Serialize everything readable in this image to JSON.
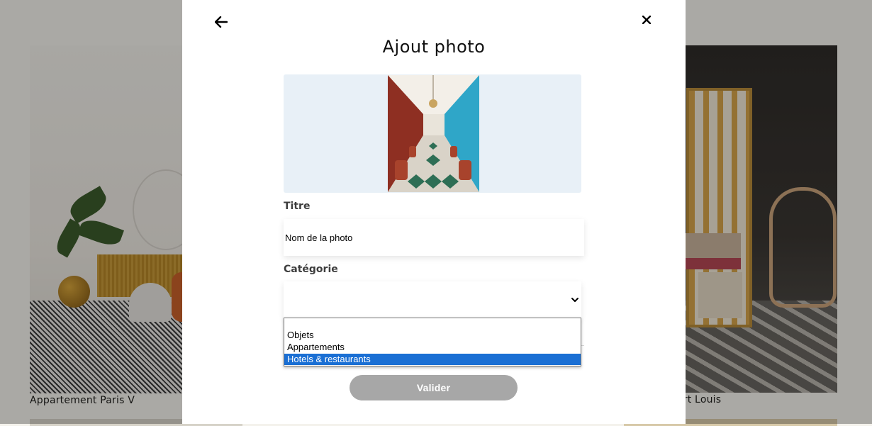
{
  "gallery": {
    "left_caption": "Appartement Paris V",
    "right_caption": "ort Louis"
  },
  "modal": {
    "title": "Ajout photo",
    "back_icon": "arrow-left-icon",
    "close_icon": "close-icon",
    "title_label": "Titre",
    "title_input_value": "Nom de la photo",
    "category_label": "Catégorie",
    "category_selected": "",
    "category_options": [
      "Objets",
      "Appartements",
      "Hotels & restaurants"
    ],
    "highlighted_option": "Hotels & restaurants",
    "submit_label": "Valider",
    "colors": {
      "preview_bg": "#e8f0f7",
      "highlight": "#1a6fd4",
      "button_disabled": "#a7a7a7",
      "overlay": "rgba(0,0,0,0.30)"
    }
  }
}
